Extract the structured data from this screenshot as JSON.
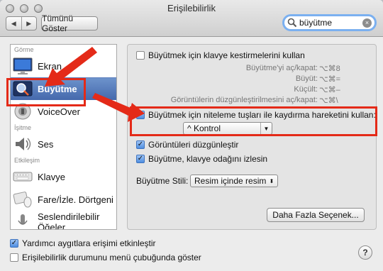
{
  "window": {
    "title": "Erişilebilirlik"
  },
  "toolbar": {
    "back": "◀",
    "forward": "▶",
    "show_all": "Tümünü Göster"
  },
  "search": {
    "value": "büyütme",
    "clear": "×"
  },
  "sidebar": {
    "sections": {
      "seeing": "Görme",
      "hearing": "İşitme",
      "interacting": "Etkileşim"
    },
    "items": {
      "display": "Ekran",
      "zoom": "Büyütme",
      "voiceover": "VoiceOver",
      "audio": "Ses",
      "keyboard": "Klavye",
      "mouse": "Fare/İzle. Dörtgeni",
      "speakable": "Seslendirilebilir Öğeler"
    }
  },
  "panel": {
    "keyboard_shortcuts": "Büyütmek için klavye kestirmelerini kullan",
    "shortcuts": [
      {
        "label": "Büyütme'yi aç/kapat:",
        "keys": "⌥⌘8"
      },
      {
        "label": "Büyüt:",
        "keys": "⌥⌘="
      },
      {
        "label": "Küçült:",
        "keys": "⌥⌘–"
      },
      {
        "label": "Görüntülerin düzgünleştirilmesini aç/kapat:",
        "keys": "⌥⌘\\"
      }
    ],
    "scroll_gesture": "Büyütmek için niteleme tuşları ile kaydırma hareketini kullan:",
    "modifier_value": "^ Kontrol",
    "smooth_images": "Görüntüleri düzgünleştir",
    "follow_focus": "Büyütme, klavye odağını izlesin",
    "zoom_style_label": "Büyütme Stili:",
    "zoom_style_value": "Resim içinde resim",
    "more_options": "Daha Fazla Seçenek..."
  },
  "bottom": {
    "enable_assistive": "Yardımcı aygıtlara erişimi etkinleştir",
    "show_in_menubar": "Erişilebilirlik durumunu menü çubuğunda göster",
    "help": "?"
  },
  "colors": {
    "highlight": "#4d72b3",
    "annotation": "#e42a18",
    "focus_ring": "#7bb0f0"
  }
}
